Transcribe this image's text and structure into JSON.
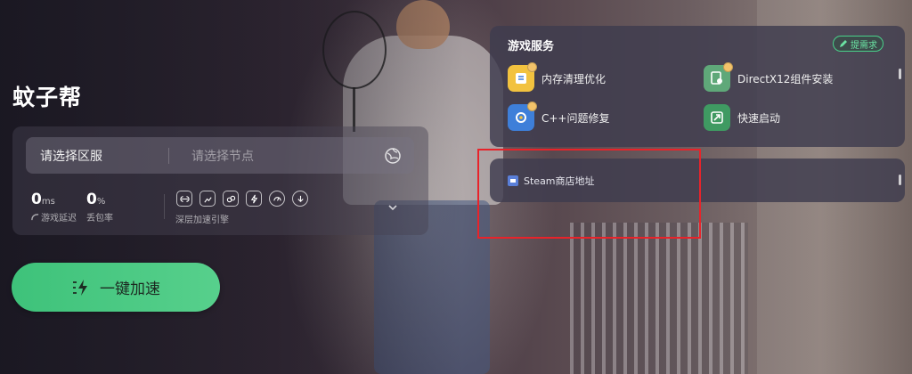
{
  "app": {
    "title": "蚊子帮"
  },
  "connection": {
    "server_label": "请选择区服",
    "node_placeholder": "请选择节点",
    "latency": {
      "value": "0",
      "unit": "ms",
      "label": "游戏延迟"
    },
    "packet_loss": {
      "value": "0",
      "unit": "%",
      "label": "丢包率"
    },
    "engine_label": "深层加速引擎",
    "engine_icons": [
      "link-icon",
      "image-icon",
      "chain-icon",
      "bolt-outline-icon",
      "speed-gauge-icon",
      "download-icon"
    ]
  },
  "accelerate_button": {
    "label": "一键加速"
  },
  "services": {
    "title": "游戏服务",
    "request_label": "提需求",
    "items": [
      {
        "label": "内存清理优化",
        "icon": "memory-clean-icon",
        "color": "#f2c23f"
      },
      {
        "label": "DirectX12组件安装",
        "icon": "directx-icon",
        "color": "#5fa879"
      },
      {
        "label": "C++问题修复",
        "icon": "cpp-repair-icon",
        "color": "#3e7fd9"
      },
      {
        "label": "快速启动",
        "icon": "quick-start-icon",
        "color": "#3f9a62"
      }
    ]
  },
  "steam": {
    "label": "Steam商店地址",
    "icon": "steam-store-icon"
  },
  "colors": {
    "accent_green": "#3ec27a",
    "highlight_red": "#e8232a"
  }
}
